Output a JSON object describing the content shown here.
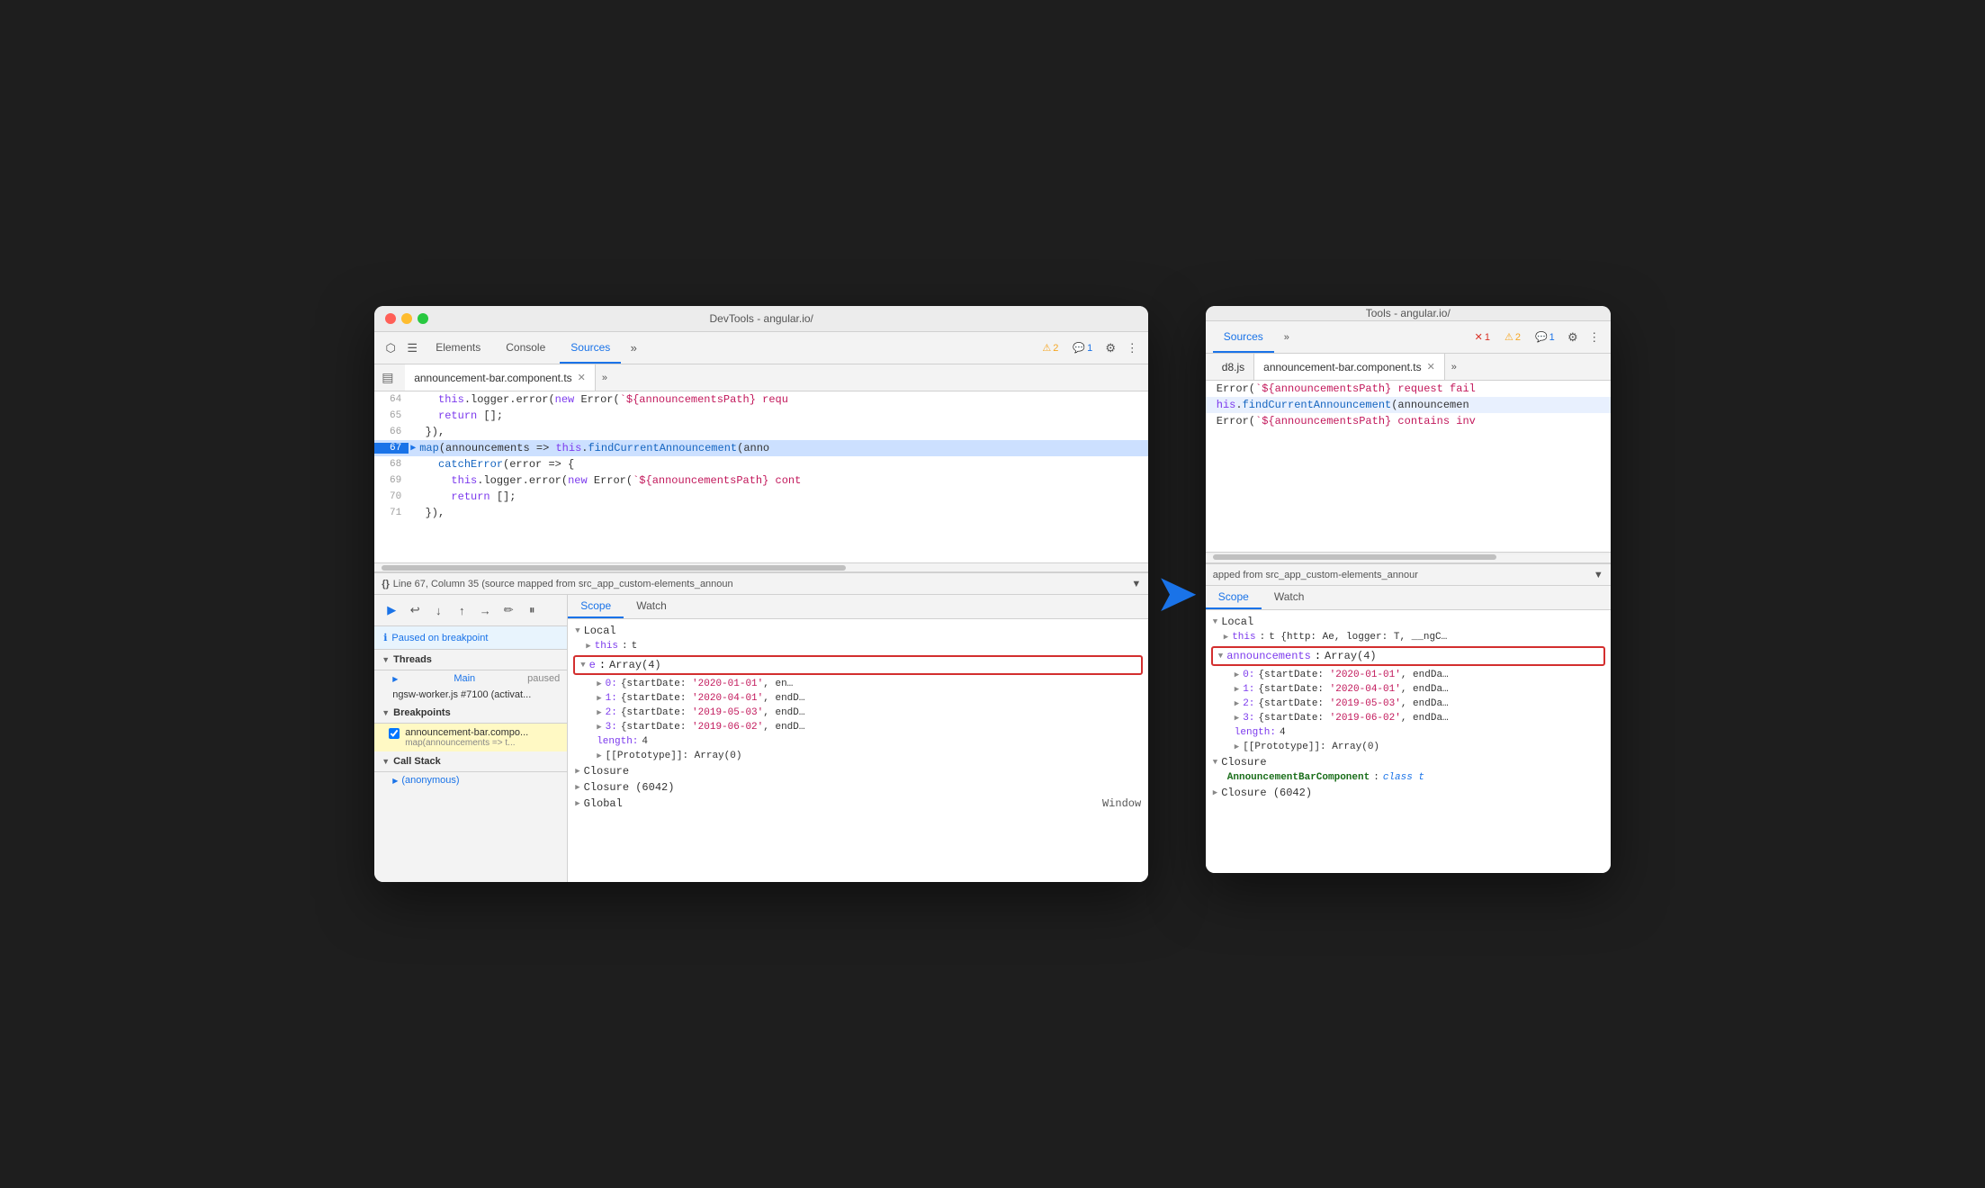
{
  "left_window": {
    "title": "DevTools - angular.io/",
    "tabs": [
      "Elements",
      "Console",
      "Sources"
    ],
    "active_tab": "Sources",
    "badges": [
      {
        "icon": "⚠",
        "count": "2",
        "type": "warning"
      },
      {
        "icon": "💬",
        "count": "1",
        "type": "info"
      }
    ],
    "file_tab": "announcement-bar.component.ts",
    "code_lines": [
      {
        "num": "64",
        "code": "    this.logger.error(new Error(`${announcementsPath} requ",
        "highlight": false,
        "bp": false
      },
      {
        "num": "65",
        "code": "    return [];",
        "highlight": false,
        "bp": false
      },
      {
        "num": "66",
        "code": "  }),",
        "highlight": false,
        "bp": false
      },
      {
        "num": "67",
        "code": "map(announcements => this.findCurrentAnnouncement(anno",
        "highlight": true,
        "bp": true,
        "current": true
      },
      {
        "num": "68",
        "code": "catchError(error => {",
        "highlight": false,
        "bp": false
      },
      {
        "num": "69",
        "code": "  this.logger.error(new Error(`${announcementsPath} cont",
        "highlight": false,
        "bp": false
      },
      {
        "num": "70",
        "code": "  return [];",
        "highlight": false,
        "bp": false
      },
      {
        "num": "71",
        "code": "})",
        "highlight": false,
        "bp": false
      }
    ],
    "status_bar": "Line 67, Column 35 (source mapped from src_app_custom-elements_announ",
    "paused_label": "Paused on breakpoint",
    "threads_label": "Threads",
    "threads": [
      {
        "name": "Main",
        "status": "paused",
        "active": true
      },
      {
        "name": "ngsw-worker.js #7100 (activat...",
        "status": "",
        "active": false
      }
    ],
    "breakpoints_label": "Breakpoints",
    "breakpoints": [
      {
        "checked": true,
        "file": "announcement-bar.compo...",
        "code": "map(announcements => t...",
        "highlighted": true
      }
    ],
    "call_stack_label": "Call Stack",
    "call_stack": [
      {
        "name": "(anonymous)"
      }
    ],
    "scope_tabs": [
      "Scope",
      "Watch"
    ],
    "active_scope_tab": "Scope",
    "scope_sections": [
      {
        "name": "Local",
        "expanded": true,
        "items": [
          {
            "label": "this",
            "value": "t",
            "expandable": true
          },
          {
            "label": "e",
            "value": "Array(4)",
            "highlighted": true,
            "expandable": true,
            "expanded": true
          }
        ],
        "sub_items": [
          {
            "label": "0:",
            "value": "{startDate: '2020-01-01', en..."
          },
          {
            "label": "1:",
            "value": "{startDate: '2020-04-01', endD..."
          },
          {
            "label": "2:",
            "value": "{startDate: '2019-05-03', endD..."
          },
          {
            "label": "3:",
            "value": "{startDate: '2019-06-02', endD..."
          },
          {
            "label": "length:",
            "value": "4"
          },
          {
            "label": "[[Prototype]]:",
            "value": "Array(0)"
          }
        ]
      },
      {
        "name": "Closure",
        "expanded": false
      },
      {
        "name": "Closure (6042)",
        "expanded": false
      },
      {
        "name": "Global",
        "value": "Window",
        "expanded": false
      }
    ]
  },
  "right_window": {
    "title": "Tools - angular.io/",
    "tabs": [
      "Sources"
    ],
    "active_tab": "Sources",
    "badges": [
      {
        "icon": "✕",
        "count": "1",
        "type": "error"
      },
      {
        "icon": "⚠",
        "count": "2",
        "type": "warning"
      },
      {
        "icon": "💬",
        "count": "1",
        "type": "info"
      }
    ],
    "file_tabs": [
      "d8.js",
      "announcement-bar.component.ts"
    ],
    "active_file_tab": "announcement-bar.component.ts",
    "code_lines": [
      {
        "text": "Error(`${announcementsPath} request fail"
      },
      {
        "text": "his.findCurrentAnnouncement(announcemen",
        "highlight": true
      },
      {
        "text": "Error(`${announcementsPath} contains inv"
      }
    ],
    "status_bar": "apped from src_app_custom-elements_annour",
    "scope_tabs": [
      "Scope",
      "Watch"
    ],
    "active_scope_tab": "Scope",
    "scope_sections": [
      {
        "name": "Local",
        "expanded": true,
        "items": [
          {
            "label": "this",
            "value": "t {http: Ae, logger: T, __ngC...",
            "expandable": true
          },
          {
            "label": "announcements",
            "value": "Array(4)",
            "highlighted": true,
            "expandable": true,
            "expanded": true
          }
        ],
        "sub_items": [
          {
            "label": "0:",
            "value": "{startDate: '2020-01-01', endDa..."
          },
          {
            "label": "1:",
            "value": "{startDate: '2020-04-01', endDa..."
          },
          {
            "label": "2:",
            "value": "{startDate: '2019-05-03', endDa..."
          },
          {
            "label": "3:",
            "value": "{startDate: '2019-06-02', endDa..."
          },
          {
            "label": "length:",
            "value": "4"
          },
          {
            "label": "[[Prototype]]:",
            "value": "Array(0)"
          }
        ]
      },
      {
        "name": "Closure",
        "expanded": false,
        "items": [
          {
            "label": "AnnouncementBarComponent",
            "value": "class t",
            "class": true
          }
        ]
      },
      {
        "name": "Closure (6042)",
        "expanded": false
      }
    ]
  },
  "arrow": {
    "symbol": "➤"
  }
}
